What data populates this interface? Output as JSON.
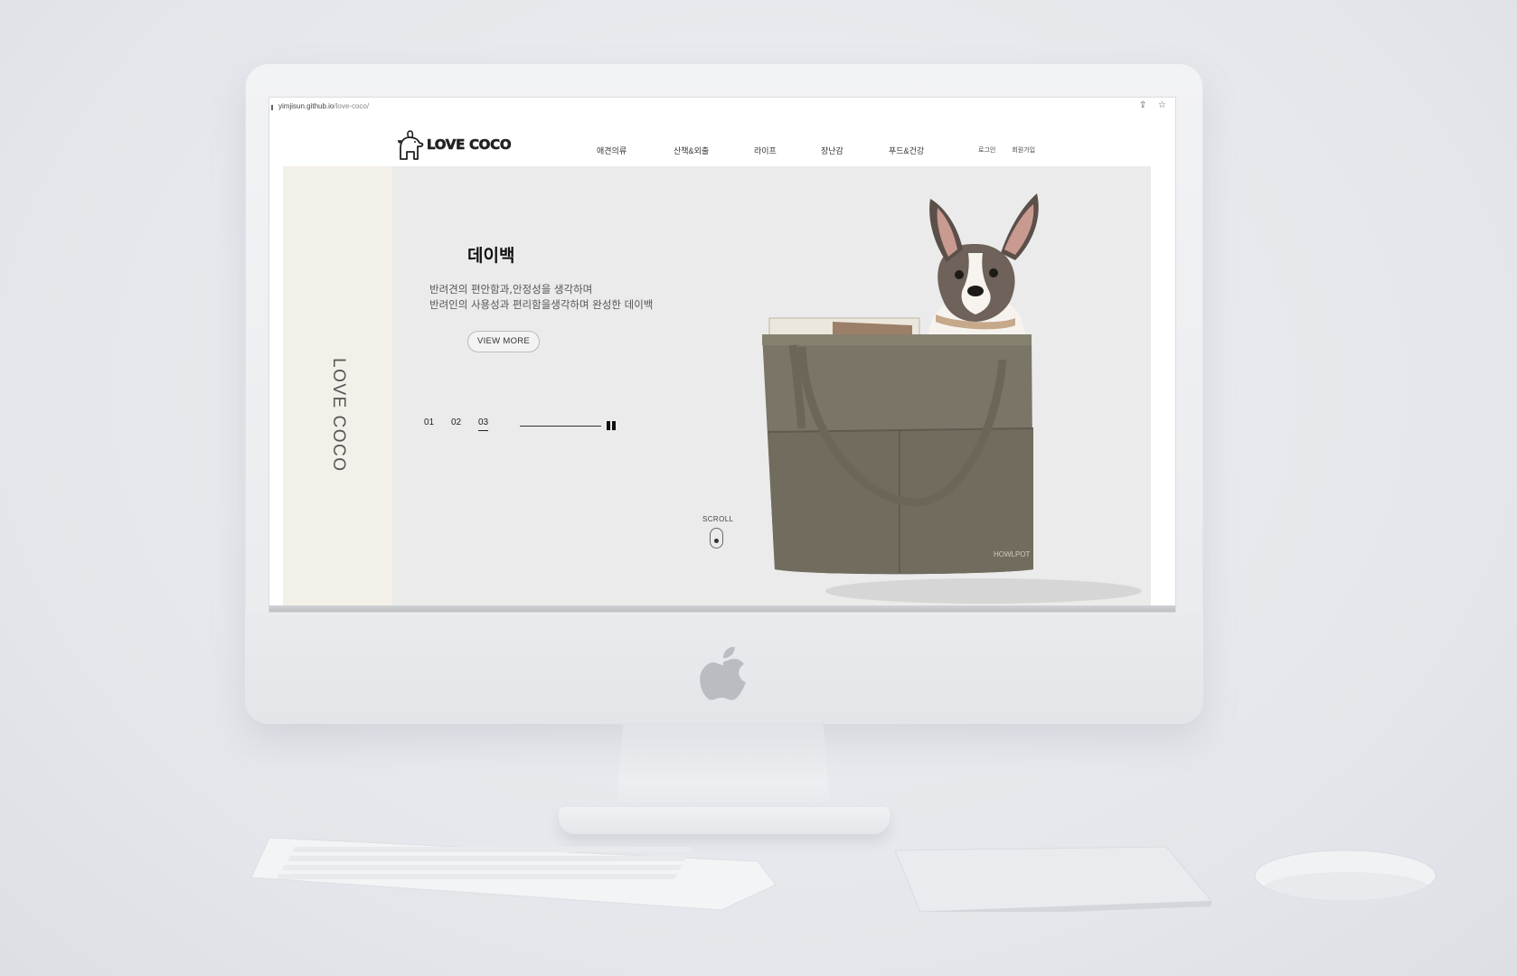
{
  "browser": {
    "url_host": "yimjisun.github.io",
    "url_path": "/love-coco/",
    "icons": [
      "share-icon",
      "star-icon"
    ]
  },
  "site": {
    "logo_text": "LOVE COCO",
    "nav": [
      "애견의류",
      "산책&외출",
      "라이프",
      "장난감",
      "푸드&건강"
    ],
    "util": {
      "login": "로그인",
      "signup": "회원가입"
    }
  },
  "hero": {
    "side_text": "LOVE COCO",
    "title": "데이백",
    "desc_line1": "반려견의 편안함과,안정성을 생각하며",
    "desc_line2": "반려인의 사용성과 편리함을생각하며 완성한 데이백",
    "button": "VIEW MORE",
    "pager": [
      "01",
      "02",
      "03"
    ],
    "active_page": "03",
    "progress": 1.0,
    "scroll_label": "SCROLL",
    "product_brand": "HOWLPOT"
  },
  "colors": {
    "hero_bg": "#ebebeb",
    "side_panel": "#f3efe9",
    "bag": "#7a7566",
    "desk": "#e3e6ea"
  }
}
